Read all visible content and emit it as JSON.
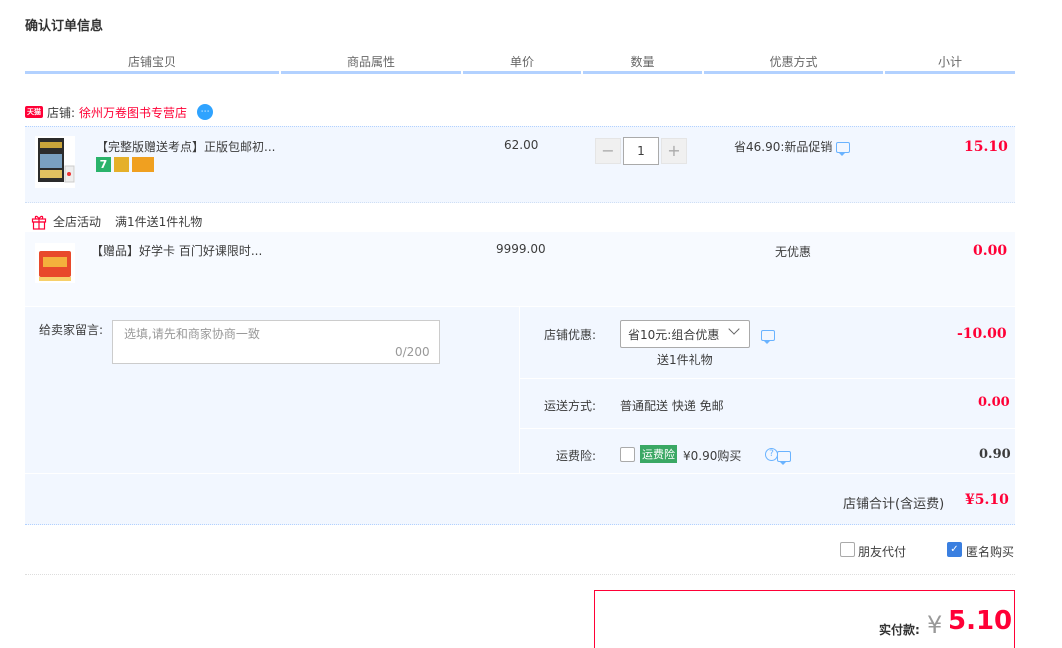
{
  "page": {
    "title": "确认订单信息"
  },
  "table_headers": [
    "店铺宝贝",
    "商品属性",
    "单价",
    "数量",
    "优惠方式",
    "小计"
  ],
  "shop": {
    "badge": "天猫",
    "label": "店铺:",
    "name": "徐州万卷图书专营店",
    "ww_icon": "chat-bubble-icon"
  },
  "item": {
    "title": "【完整版赠送考点】正版包邮初...",
    "price": "62.00",
    "quantity": "1",
    "minus": "−",
    "plus": "+",
    "promo": "省46.90:新品促销",
    "subtotal": "15.10",
    "service_icons": [
      "7-day-return-icon",
      "guarantee-icon",
      "credit-card-icon"
    ]
  },
  "activity": {
    "label": "全店活动",
    "desc": "满1件送1件礼物"
  },
  "gift_item": {
    "title": "【赠品】好学卡 百门好课限时...",
    "price": "9999.00",
    "promo": "无优惠",
    "subtotal": "0.00"
  },
  "message": {
    "label": "给卖家留言:",
    "placeholder": "选填,请先和商家协商一致",
    "count": "0/200"
  },
  "shop_discount": {
    "label": "店铺优惠:",
    "selected": "省10元:组合优惠",
    "note": "送1件礼物",
    "amount": "-10.00"
  },
  "shipping": {
    "label": "运送方式:",
    "value": "普通配送 快递 免邮",
    "amount": "0.00"
  },
  "insurance": {
    "label": "运费险:",
    "tag": "运费险",
    "desc": "¥0.90购买",
    "amount": "0.90"
  },
  "shop_total": {
    "label": "店铺合计(含运费)",
    "amount": "¥5.10"
  },
  "options": {
    "friend_pay": "朋友代付",
    "anonymous": "匿名购买"
  },
  "payment": {
    "label": "实付款:",
    "currency": "¥",
    "amount": "5.10"
  },
  "colors": {
    "accent_red": "#ff0036",
    "header_line": "#b2d1ff",
    "panel_bg": "#f2f7ff"
  }
}
